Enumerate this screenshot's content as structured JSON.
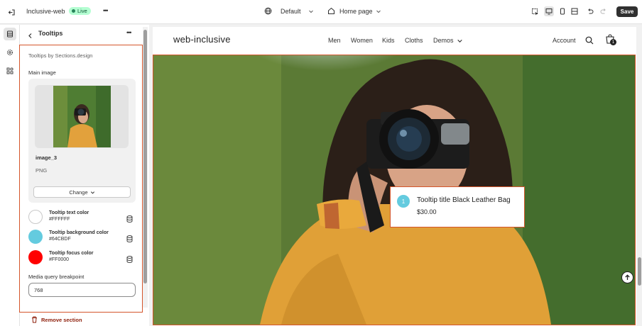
{
  "topbar": {
    "store_name": "Inclusive-web",
    "status_badge": "Live",
    "more_label": "•••",
    "theme_select": "Default",
    "page_select": "Home page",
    "save_label": "Save"
  },
  "panel": {
    "title": "Tooltips",
    "more_label": "•••",
    "section_source": "Tooltips by Sections.design",
    "main_image_label": "Main image",
    "image_name": "image_3",
    "image_type": "PNG",
    "change_label": "Change",
    "colors": [
      {
        "label": "Tooltip text color",
        "hex": "#FFFFFF",
        "swatch": "#ffffff"
      },
      {
        "label": "Tooltip background color",
        "hex": "#64CBDF",
        "swatch": "#64cbdf"
      },
      {
        "label": "Tooltip focus color",
        "hex": "#FF0000",
        "swatch": "#ff0000"
      }
    ],
    "breakpoint_label": "Media query breakpoint",
    "breakpoint_value": "768",
    "remove_label": "Remove section"
  },
  "site": {
    "logo": "web-inclusive",
    "nav": [
      "Men",
      "Women",
      "Kids",
      "Cloths",
      "Demos"
    ],
    "account_label": "Account",
    "cart_count": "1"
  },
  "tooltip": {
    "number": "1",
    "title": "Tooltip title Black Leather Bag",
    "price": "$30.00"
  },
  "colors": {
    "accent_highlight": "#d4552b",
    "live_badge": "#b4fed2",
    "remove_text": "#8e1f0b"
  }
}
